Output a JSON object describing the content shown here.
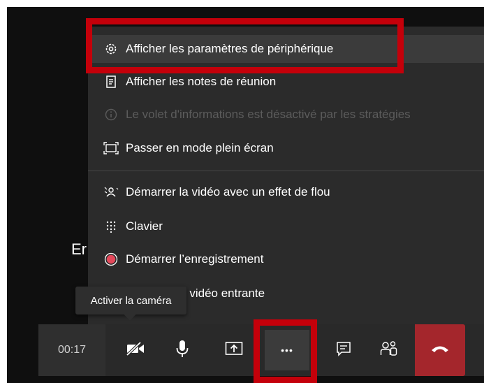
{
  "background": {
    "partial_text": "Er"
  },
  "menu": {
    "items": [
      {
        "label": "Afficher les paramètres de périphérique",
        "icon": "gear-icon",
        "disabled": false
      },
      {
        "label": "Afficher les notes de réunion",
        "icon": "notes-icon",
        "disabled": false
      },
      {
        "label": "Le volet d'informations est désactivé par les stratégies",
        "icon": "info-icon",
        "disabled": true
      },
      {
        "label": "Passer en mode plein écran",
        "icon": "fullscreen-icon",
        "disabled": false
      },
      {
        "label": "Démarrer la vidéo avec un effet de flou",
        "icon": "blur-icon",
        "disabled": false
      },
      {
        "label": "Clavier",
        "icon": "keypad-icon",
        "disabled": false
      },
      {
        "label": "Démarrer l’enregistrement",
        "icon": "record-icon",
        "disabled": false
      },
      {
        "label": "r la vidéo entrante",
        "icon": "video-icon",
        "disabled": false
      }
    ]
  },
  "tooltip": {
    "label": "Activer la caméra"
  },
  "toolbar": {
    "timer": "00:17",
    "more_label": "•••",
    "colors": {
      "hangup": "#a4262c",
      "record": "#e3485a",
      "highlight": "#c4000a"
    }
  }
}
